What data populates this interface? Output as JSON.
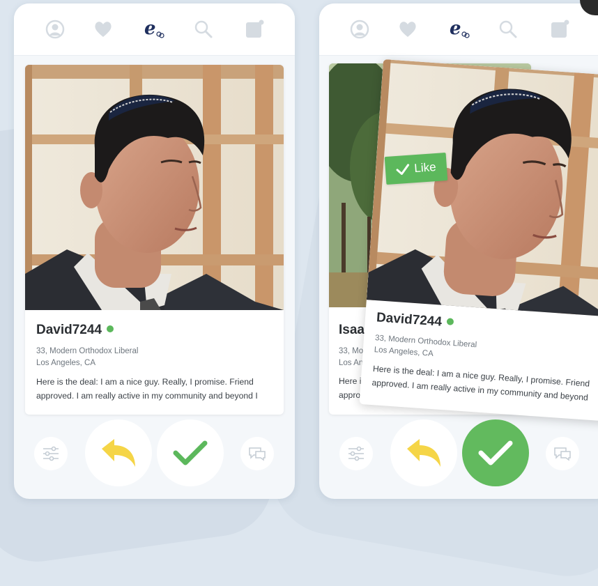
{
  "app": {
    "logo_letter": "e"
  },
  "nav": {
    "icons": [
      "profile-icon",
      "heart-icon",
      "logo-icon",
      "search-icon",
      "messages-icon"
    ]
  },
  "left_screen": {
    "profile": {
      "name": "David7244",
      "online": true,
      "details": "33, Modern Orthodox Liberal",
      "location": "Los Angeles, CA",
      "bio": "Here is the deal: I am a nice guy. Really, I promise. Friend approved. I am really active in my community and beyond I"
    },
    "actions": [
      "filters-icon",
      "undo-icon",
      "like-icon",
      "chat-icon"
    ]
  },
  "right_screen": {
    "back_profile": {
      "name": "Isaac",
      "details": "33, Mode",
      "location": "Los Ange",
      "bio_line1": "Here is t",
      "bio_line2": "approve"
    },
    "swiped_profile": {
      "name": "David7244",
      "online": true,
      "details": "33, Modern Orthodox Liberal",
      "location": "Los Angeles, CA",
      "bio_line1": "Here is the deal: I am a nice guy. Really, I promise. Friend",
      "bio_line2": "approved. I am really active in my community and beyond"
    },
    "like_stamp": "Like",
    "actions": [
      "filters-icon",
      "undo-icon",
      "like-icon-active",
      "chat-icon"
    ]
  },
  "colors": {
    "accent_green": "#5cb85c",
    "undo_yellow": "#f5d547",
    "logo_navy": "#1f2f5e",
    "icon_grey": "#d5dbe1",
    "background": "#dde6ef"
  }
}
